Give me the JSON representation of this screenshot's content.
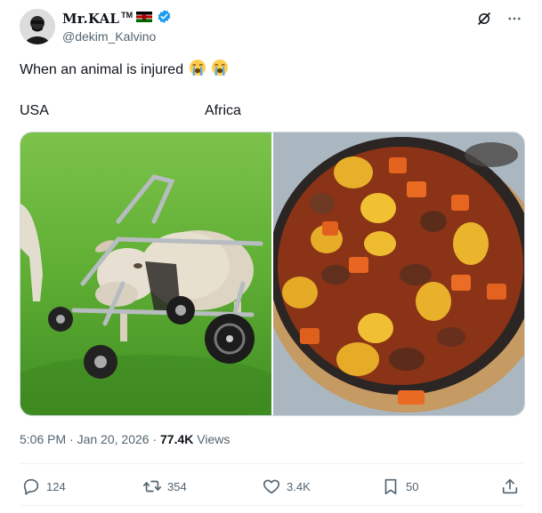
{
  "author": {
    "display_name": "Mr.KAL",
    "trademark": "TM",
    "handle": "@dekim_Kalvino",
    "verified": true,
    "flag": "kenya-flag-icon"
  },
  "tweet": {
    "text": "When an animal is injured",
    "emojis": [
      "loudly-crying-face-icon",
      "loudly-crying-face-icon"
    ]
  },
  "media": {
    "left_caption": "USA",
    "right_caption": "Africa",
    "left_image": "sheep-in-wheelchair-photo",
    "right_image": "beef-stew-photo"
  },
  "meta": {
    "time": "5:06 PM",
    "separator": "·",
    "date": "Jan 20, 2026",
    "views_count": "77.4K",
    "views_label": "Views"
  },
  "actions": {
    "replies": "124",
    "reposts": "354",
    "likes": "3.4K",
    "bookmarks": "50"
  },
  "colors": {
    "text_primary": "#0f1419",
    "text_secondary": "#536471",
    "verified_blue": "#1d9bf0",
    "divider": "#eff3f4"
  }
}
